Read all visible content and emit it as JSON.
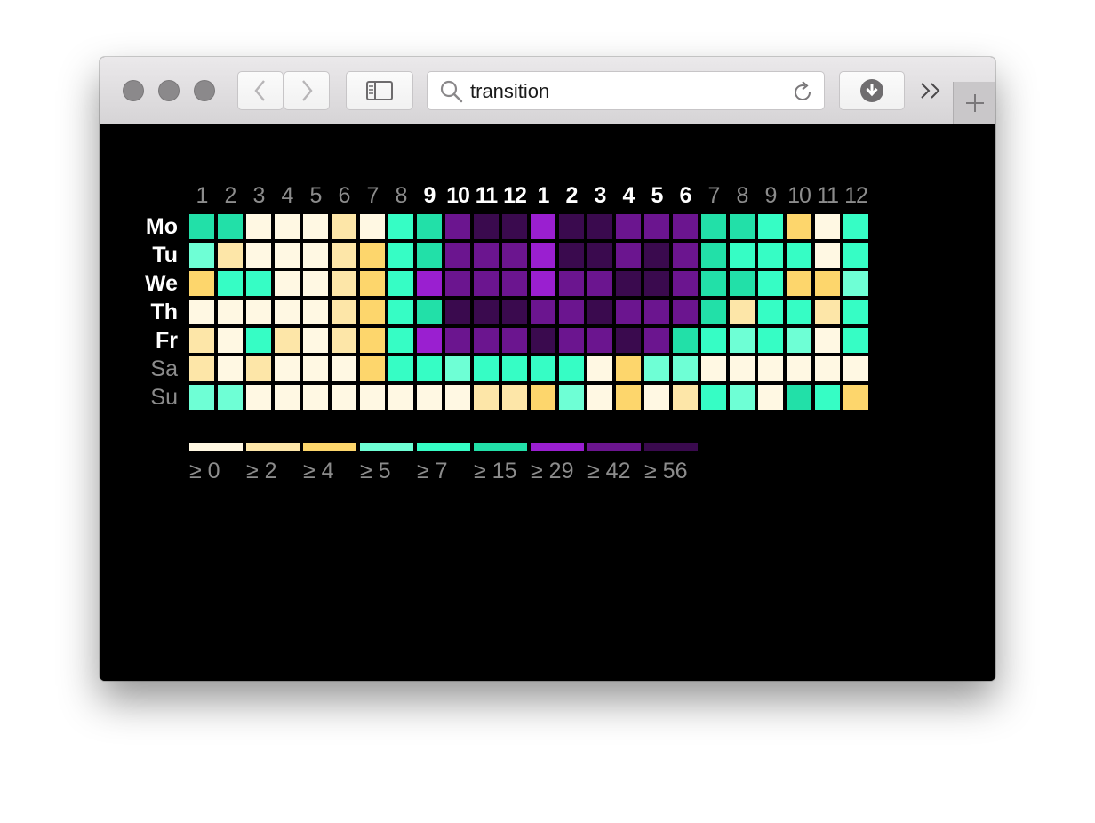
{
  "browser": {
    "search_text": "transition",
    "icons": [
      "back-icon",
      "forward-icon",
      "sidebar-icon",
      "search-icon",
      "reload-icon",
      "download-icon",
      "overflow-chevrons-icon",
      "new-tab-plus-icon"
    ]
  },
  "chart_data": {
    "type": "heatmap",
    "title": "",
    "x_labels": [
      "1",
      "2",
      "3",
      "4",
      "5",
      "6",
      "7",
      "8",
      "9",
      "10",
      "11",
      "12",
      "1",
      "2",
      "3",
      "4",
      "5",
      "6",
      "7",
      "8",
      "9",
      "10",
      "11",
      "12"
    ],
    "x_highlighted": [
      false,
      false,
      false,
      false,
      false,
      false,
      false,
      false,
      true,
      true,
      true,
      true,
      true,
      true,
      true,
      true,
      true,
      true,
      false,
      false,
      false,
      false,
      false,
      false
    ],
    "y_labels": [
      "Mo",
      "Tu",
      "We",
      "Th",
      "Fr",
      "Sa",
      "Su"
    ],
    "y_highlighted": [
      true,
      true,
      true,
      true,
      true,
      false,
      false
    ],
    "thresholds": [
      0,
      2,
      4,
      5,
      7,
      15,
      29,
      42,
      56
    ],
    "legend_labels": [
      "≥ 0",
      "≥ 2",
      "≥ 4",
      "≥ 5",
      "≥ 7",
      "≥ 15",
      "≥ 29",
      "≥ 42",
      "≥ 56"
    ],
    "colors": [
      "#fff8e3",
      "#fde6a8",
      "#fdd66c",
      "#6effd5",
      "#36fdc5",
      "#22e0a8",
      "#9a1fd0",
      "#6b158f",
      "#3a0a4e"
    ],
    "levels": [
      [
        5,
        5,
        0,
        0,
        0,
        1,
        0,
        4,
        5,
        7,
        8,
        8,
        6,
        8,
        8,
        7,
        7,
        7,
        5,
        5,
        4,
        2,
        0,
        4
      ],
      [
        3,
        1,
        0,
        0,
        0,
        1,
        2,
        4,
        5,
        7,
        7,
        7,
        6,
        8,
        8,
        7,
        8,
        7,
        5,
        4,
        4,
        4,
        0,
        4
      ],
      [
        2,
        4,
        4,
        0,
        0,
        1,
        2,
        4,
        6,
        7,
        7,
        7,
        6,
        7,
        7,
        8,
        8,
        7,
        5,
        5,
        4,
        2,
        2,
        3
      ],
      [
        0,
        0,
        0,
        0,
        0,
        1,
        2,
        4,
        5,
        8,
        8,
        8,
        7,
        7,
        8,
        7,
        7,
        7,
        5,
        1,
        4,
        4,
        1,
        4
      ],
      [
        1,
        0,
        4,
        1,
        0,
        1,
        2,
        4,
        6,
        7,
        7,
        7,
        8,
        7,
        7,
        8,
        7,
        5,
        4,
        3,
        4,
        3,
        0,
        4
      ],
      [
        1,
        0,
        1,
        0,
        0,
        0,
        2,
        4,
        4,
        3,
        4,
        4,
        4,
        4,
        0,
        2,
        3,
        3,
        0,
        0,
        0,
        0,
        0,
        0
      ],
      [
        3,
        3,
        0,
        0,
        0,
        0,
        0,
        0,
        0,
        0,
        1,
        1,
        2,
        3,
        0,
        2,
        0,
        1,
        4,
        3,
        0,
        5,
        4,
        2
      ]
    ]
  }
}
